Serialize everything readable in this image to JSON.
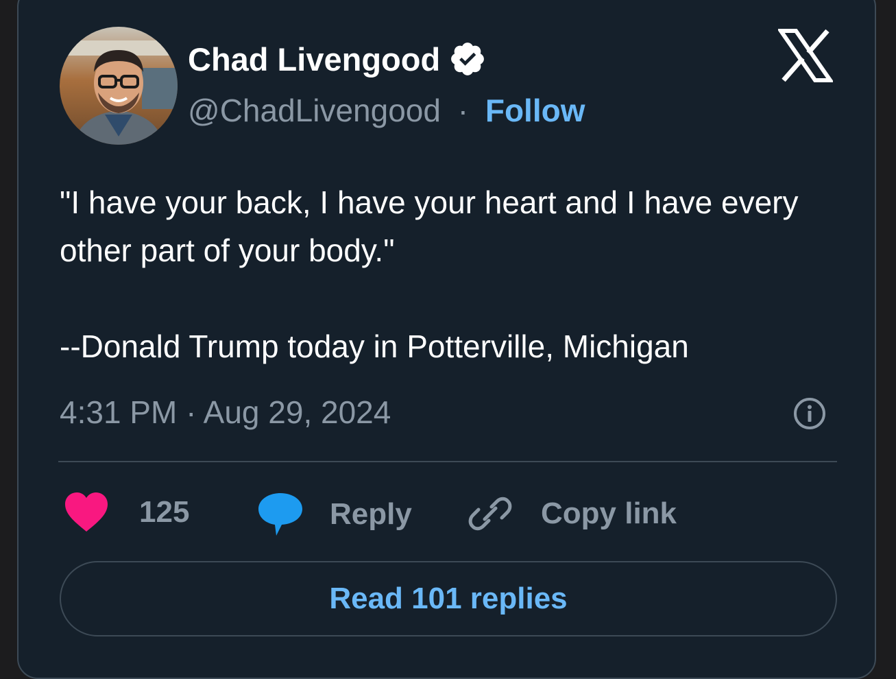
{
  "author": {
    "name": "Chad Livengood",
    "handle": "@ChadLivengood",
    "separator": "·",
    "follow_label": "Follow"
  },
  "tweet": {
    "lines": [
      "\"I have your back, I have your heart and I have every other part of your body.\"",
      "--Donald Trump today in Potterville, Michigan"
    ],
    "timestamp": "4:31 PM · Aug 29, 2024"
  },
  "actions": {
    "likes_count": "125",
    "reply_label": "Reply",
    "copy_link_label": "Copy link"
  },
  "read_replies_label": "Read 101 replies",
  "icons": [
    "verified-badge-icon",
    "x-logo-icon",
    "info-icon",
    "heart-icon",
    "reply-bubble-icon",
    "link-icon"
  ],
  "colors": {
    "background": "#15202b",
    "accent": "#6ab8f7",
    "heart": "#f91880",
    "reply": "#1d9bf0",
    "muted": "#8b98a5"
  }
}
